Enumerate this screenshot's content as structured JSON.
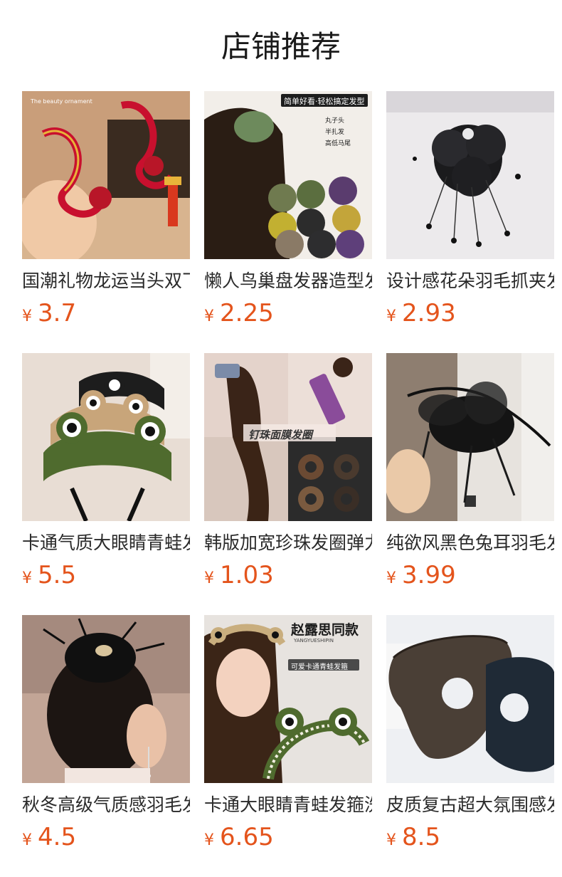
{
  "header": {
    "title": "店铺推荐"
  },
  "currency_symbol": "¥",
  "accent_color": "#e4541c",
  "products": [
    {
      "name": "国潮礼物龙运当头双飞燕发夹",
      "price": "3.7",
      "image_text": "The beauty ornament"
    },
    {
      "name": "懒人鸟巢盘发器造型发夹",
      "price": "2.25",
      "image_text": "简单好看·轻松搞定发型",
      "image_list": [
        "丸子头",
        "半扎发",
        "高低马尾"
      ]
    },
    {
      "name": "设计感花朵羽毛抓夹发饰",
      "price": "2.93"
    },
    {
      "name": "卡通气质大眼睛青蛙发箍",
      "price": "5.5"
    },
    {
      "name": "韩版加宽珍珠发圈弹力发绳",
      "price": "1.03",
      "image_text": "钉珠面膜发圈"
    },
    {
      "name": "纯欲风黑色兔耳羽毛发箍",
      "price": "3.99"
    },
    {
      "name": "秋冬高级气质感羽毛发夹",
      "price": "4.5"
    },
    {
      "name": "卡通大眼睛青蛙发箍洗脸",
      "price": "6.65",
      "image_text": "赵露思同款",
      "image_subtext": "YANGYUESHIPIN",
      "image_banner": "可爱卡通青蛙发箍"
    },
    {
      "name": "皮质复古超大氛围感发圈",
      "price": "8.5"
    }
  ]
}
